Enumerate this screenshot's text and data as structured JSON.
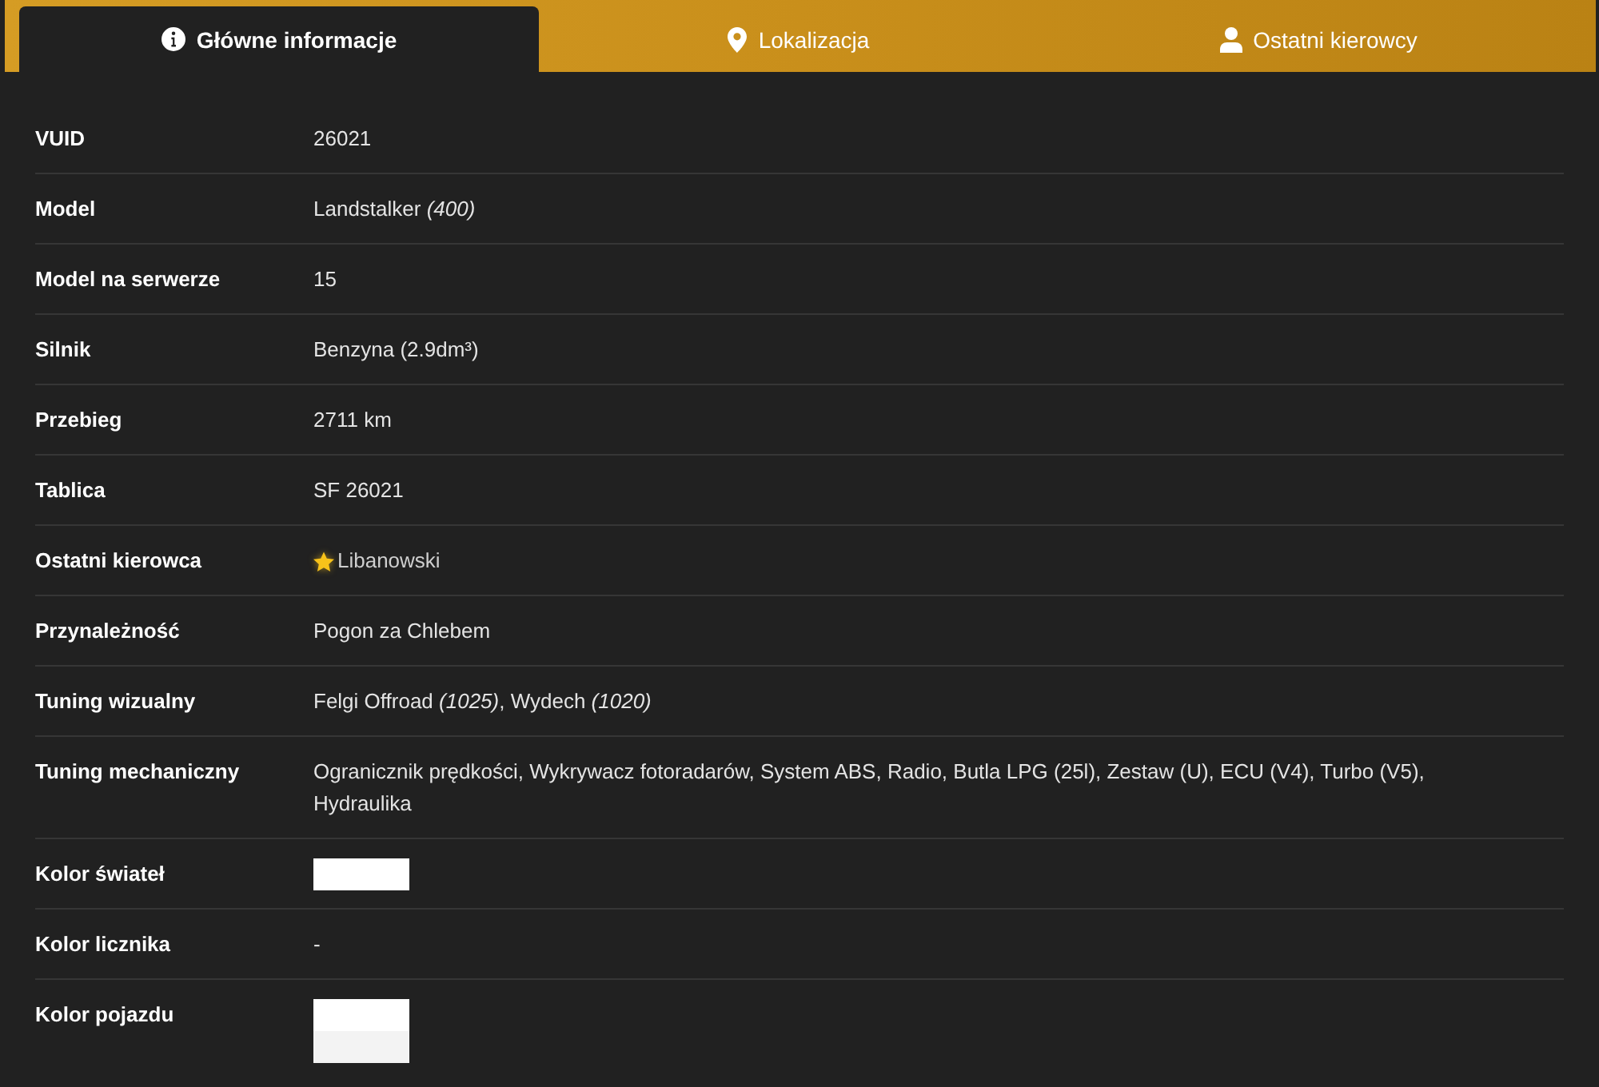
{
  "tabs": [
    {
      "label": "Główne informacje",
      "selected": true
    },
    {
      "label": "Lokalizacja",
      "selected": false
    },
    {
      "label": "Ostatni kierowcy",
      "selected": false
    }
  ],
  "rows": [
    {
      "kind": "text",
      "label": "VUID",
      "value": "26021"
    },
    {
      "kind": "text",
      "label": "Model",
      "value": "Landstalker *(400)*"
    },
    {
      "kind": "text",
      "label": "Model na serwerze",
      "value": "15"
    },
    {
      "kind": "text",
      "label": "Silnik",
      "value": "Benzyna (2.9dm³)"
    },
    {
      "kind": "text",
      "label": "Przebieg",
      "value": "2711 km"
    },
    {
      "kind": "text",
      "label": "Tablica",
      "value": "SF 26021"
    },
    {
      "kind": "driver",
      "label": "Ostatni kierowca",
      "value": "Libanowski",
      "starred": true
    },
    {
      "kind": "text",
      "label": "Przynależność",
      "value": "Pogon za Chlebem"
    },
    {
      "kind": "text",
      "label": "Tuning wizualny",
      "value": "Felgi Offroad *(1025)*, Wydech *(1020)*"
    },
    {
      "kind": "text",
      "label": "Tuning mechaniczny",
      "value": "Ogranicznik prędkości, Wykrywacz fotoradarów, System ABS, Radio, Butla LPG (25l), Zestaw (U), ECU (V4), Turbo (V5), Hydraulika"
    },
    {
      "kind": "colors",
      "label": "Kolor świateł",
      "swatches": [
        {
          "color": "#ffffff"
        }
      ]
    },
    {
      "kind": "text",
      "label": "Kolor licznika",
      "value": "-"
    },
    {
      "kind": "colors",
      "label": "Kolor pojazdu",
      "swatches": [
        {
          "color": "#ffffff"
        },
        {
          "color": "#f3f3f3"
        }
      ]
    }
  ]
}
